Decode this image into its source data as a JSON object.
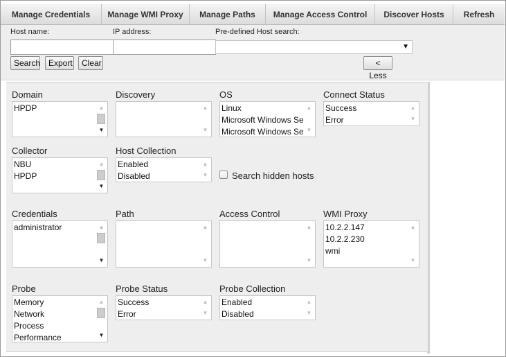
{
  "tabs": [
    "Manage Credentials",
    "Manage WMI Proxy",
    "Manage Paths",
    "Manage Access Control",
    "Discover Hosts",
    "Refresh"
  ],
  "search": {
    "host_name_label": "Host name:",
    "host_name_value": "",
    "ip_label": "IP address:",
    "ip_value": "",
    "predefined_label": "Pre-defined Host search:",
    "predefined_value": "",
    "search_btn": "Search",
    "export_btn": "Export",
    "clear_btn": "Clear",
    "less_btn": "< Less"
  },
  "filters": {
    "domain": {
      "label": "Domain",
      "options": [
        "HPDP"
      ]
    },
    "discovery": {
      "label": "Discovery",
      "options": []
    },
    "os": {
      "label": "OS",
      "options": [
        "Linux",
        "Microsoft Windows Se",
        "Microsoft Windows Se"
      ]
    },
    "connect_status": {
      "label": "Connect Status",
      "options": [
        "Success",
        "Error"
      ]
    },
    "collector": {
      "label": "Collector",
      "options": [
        "NBU",
        "HPDP"
      ]
    },
    "host_collection": {
      "label": "Host Collection",
      "options": [
        "Enabled",
        "Disabled"
      ]
    },
    "hidden_hosts": {
      "label": "Search hidden hosts",
      "checked": false
    },
    "credentials": {
      "label": "Credentials",
      "options": [
        "administrator"
      ]
    },
    "path": {
      "label": "Path",
      "options": []
    },
    "access_control": {
      "label": "Access Control",
      "options": []
    },
    "wmi_proxy": {
      "label": "WMI Proxy",
      "options": [
        "10.2.2.147",
        "10.2.2.230",
        "wmi"
      ]
    },
    "probe": {
      "label": "Probe",
      "options": [
        "Memory",
        "Network",
        "Process",
        "Performance"
      ]
    },
    "probe_status": {
      "label": "Probe Status",
      "options": [
        "Success",
        "Error"
      ]
    },
    "probe_collection": {
      "label": "Probe Collection",
      "options": [
        "Enabled",
        "Disabled"
      ]
    }
  }
}
